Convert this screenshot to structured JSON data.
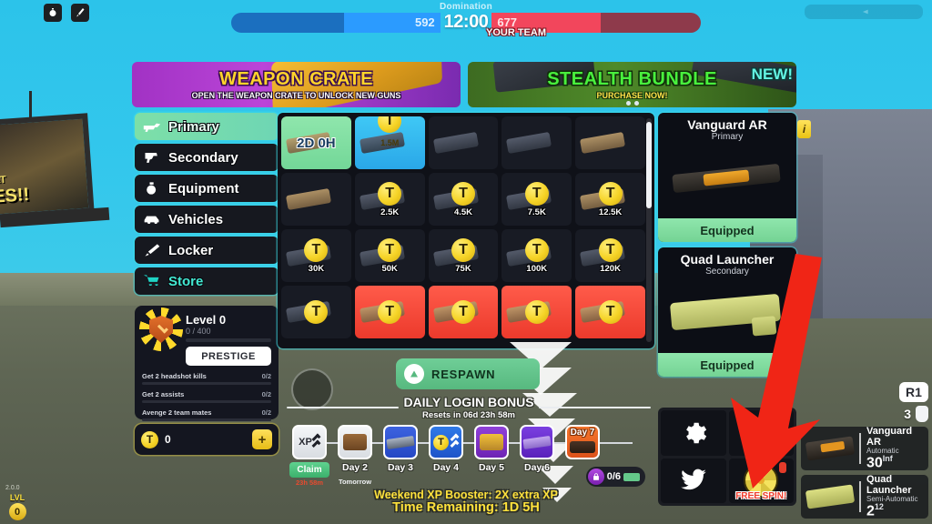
{
  "hud": {
    "mode": "Domination",
    "score_left": "592",
    "score_right": "677",
    "timer": "12:00",
    "your_team": "YOUR TEAM",
    "left_color": "#2b9bff",
    "right_color": "#f2465c"
  },
  "billboard": {
    "line1": "AT",
    "line2": "ES!!"
  },
  "banners": [
    {
      "title": "WEAPON CRATE",
      "subtitle": "OPEN THE WEAPON CRATE TO UNLOCK NEW GUNS",
      "badge": ""
    },
    {
      "title": "STEALTH BUNDLE",
      "subtitle": "PURCHASE NOW!",
      "badge": "NEW!"
    }
  ],
  "sidebar": {
    "items": [
      {
        "label": "Primary",
        "icon": "rifle-icon",
        "active": true
      },
      {
        "label": "Secondary",
        "icon": "pistol-icon",
        "active": false
      },
      {
        "label": "Equipment",
        "icon": "grenade-icon",
        "active": false
      },
      {
        "label": "Vehicles",
        "icon": "vehicle-icon",
        "active": false
      },
      {
        "label": "Locker",
        "icon": "knife-icon",
        "active": false
      },
      {
        "label": "Store",
        "icon": "cart-icon",
        "active": false
      }
    ]
  },
  "level_card": {
    "title": "Level 0",
    "xp": "0 / 400",
    "prestige_label": "PRESTIGE",
    "challenges": [
      {
        "name": "Get 2 headshot kills",
        "value": "0/2"
      },
      {
        "name": "Get 2 assists",
        "value": "0/2"
      },
      {
        "name": "Avenge 2 team mates",
        "value": "0/2"
      }
    ]
  },
  "currency": {
    "symbol": "T",
    "amount": "0",
    "add_label": "+"
  },
  "grid": {
    "rows": [
      [
        {
          "style": "green",
          "tag": "2D 0H",
          "price": "",
          "art": "tan"
        },
        {
          "style": "blue",
          "tag": "1.5M",
          "price": "",
          "art": "dark"
        },
        {
          "style": "dark",
          "tag": "",
          "price": "",
          "art": "dark"
        },
        {
          "style": "dark",
          "tag": "",
          "price": "",
          "art": "dark"
        },
        {
          "style": "dark",
          "tag": "",
          "price": "",
          "art": "tan"
        }
      ],
      [
        {
          "style": "dark",
          "tag": "",
          "price": "",
          "art": "tan"
        },
        {
          "style": "dark",
          "tag": "",
          "price": "2.5K",
          "art": "dark"
        },
        {
          "style": "dark",
          "tag": "",
          "price": "4.5K",
          "art": "dark"
        },
        {
          "style": "dark",
          "tag": "",
          "price": "7.5K",
          "art": "dark"
        },
        {
          "style": "dark",
          "tag": "",
          "price": "12.5K",
          "art": "tan"
        }
      ],
      [
        {
          "style": "dark",
          "tag": "",
          "price": "30K",
          "art": "dark"
        },
        {
          "style": "dark",
          "tag": "",
          "price": "50K",
          "art": "dark"
        },
        {
          "style": "dark",
          "tag": "",
          "price": "75K",
          "art": "dark"
        },
        {
          "style": "dark",
          "tag": "",
          "price": "100K",
          "art": "dark"
        },
        {
          "style": "dark",
          "tag": "",
          "price": "120K",
          "art": "dark"
        }
      ],
      [
        {
          "style": "dark",
          "tag": "",
          "price": "",
          "art": "dark"
        },
        {
          "style": "red",
          "tag": "",
          "price": "",
          "art": "tan"
        },
        {
          "style": "red",
          "tag": "",
          "price": "",
          "art": "tan"
        },
        {
          "style": "red",
          "tag": "",
          "price": "",
          "art": "tan"
        },
        {
          "style": "red",
          "tag": "",
          "price": "",
          "art": "tan"
        }
      ]
    ]
  },
  "equipped": [
    {
      "name": "Vanguard AR",
      "type": "Primary",
      "status": "Equipped",
      "info": "i"
    },
    {
      "name": "Quad Launcher",
      "type": "Secondary",
      "status": "Equipped",
      "info": "i"
    }
  ],
  "icon_buttons": [
    {
      "name": "gear-icon",
      "label": ""
    },
    {
      "name": "list-icon",
      "label": ""
    },
    {
      "name": "twitter-icon",
      "label": ""
    },
    {
      "name": "spin-wheel-icon",
      "label": "FREE SPIN!"
    }
  ],
  "respawn": {
    "label": "RESPAWN"
  },
  "daily": {
    "title": "DAILY LOGIN BONUS",
    "resets": "Resets in 06d 23h 58m",
    "days": [
      {
        "label": "",
        "style": "white",
        "icon": "xp-icon",
        "claim": "Claim",
        "claim_time": "23h 58m"
      },
      {
        "label": "Day 2",
        "style": "white",
        "icon": "crate-icon",
        "note": "Tomorrow"
      },
      {
        "label": "Day 3",
        "style": "blue",
        "icon": "gun-icon"
      },
      {
        "label": "Day 4",
        "style": "blue2",
        "icon": "coin-xp-icon"
      },
      {
        "label": "Day 5",
        "style": "purple",
        "icon": "treasure-icon"
      },
      {
        "label": "Day 6",
        "style": "purple2",
        "icon": "gun-purple-icon"
      },
      {
        "label": "Day 7",
        "style": "orange",
        "icon": "vehicle-icon",
        "top_label": "Day 7"
      }
    ],
    "lock": {
      "value": "0/6"
    }
  },
  "booster": {
    "line1": "Weekend XP Booster: 2X extra XP",
    "line2": "Time Remaining: 1D 5H"
  },
  "weapon_hud": {
    "r1": "R1",
    "grenades": "3",
    "weapons": [
      {
        "name": "Vanguard AR",
        "fire_mode": "Automatic",
        "ammo": "30",
        "reserve": "Inf"
      },
      {
        "name": "Quad Launcher",
        "fire_mode": "Semi-Automatic",
        "ammo": "2",
        "reserve": "12"
      }
    ]
  },
  "footer": {
    "version": "2.0.0",
    "lvl_label": "LVL",
    "lvl_value": "0"
  }
}
